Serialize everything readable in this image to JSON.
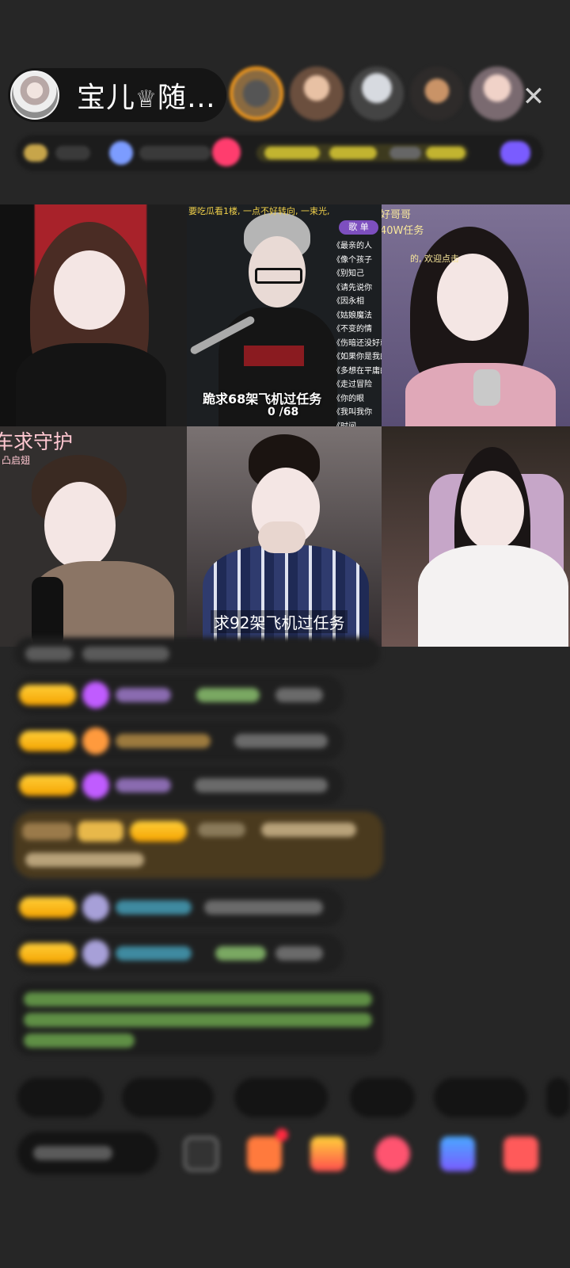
{
  "host": {
    "name": "宝儿",
    "crown": "♕",
    "name_suffix": "随…"
  },
  "header": {
    "close_glyph": "✕"
  },
  "video_tiles": {
    "tile2": {
      "top_caption": "要吃瓜看1楼, 一点不好转向, 一束光,",
      "songlist_label": "歌 单",
      "songs": [
        "《最亲的人",
        "《像个孩子",
        "《别知己",
        "《请先说你",
        "《因永相",
        "《姑娘魔法",
        "《不变的情",
        "《伤暗还没好就",
        "《如果你是我的",
        "《多想在平庸的生",
        "《走过冒险",
        "《你的眼",
        "《我叫我你",
        "《时间"
      ],
      "task_text": "跪求68架飞机过任务",
      "task_count": "0 /68"
    },
    "tile3": {
      "line1": "好哥哥",
      "line2": "40W任务",
      "line3": "的, 欢迎点击"
    },
    "tile4": {
      "line1": "车求守护",
      "line2": "凸启翅"
    },
    "tile5": {
      "task_text": "求92架飞机过任务"
    }
  },
  "colors": {
    "background": "#262626",
    "badge_gold": "#f5a300",
    "accent_pink": "#ff3d6e",
    "chat_green": "#a8d86c",
    "chat_purple": "#c28cff",
    "chat_teal": "#4ec3d8",
    "gift_banner": "#4a3a1e"
  },
  "icons": {
    "close": "close-icon",
    "crown": "crown-icon",
    "gift": "gift-icon",
    "share": "share-icon",
    "heart": "heart-icon"
  }
}
